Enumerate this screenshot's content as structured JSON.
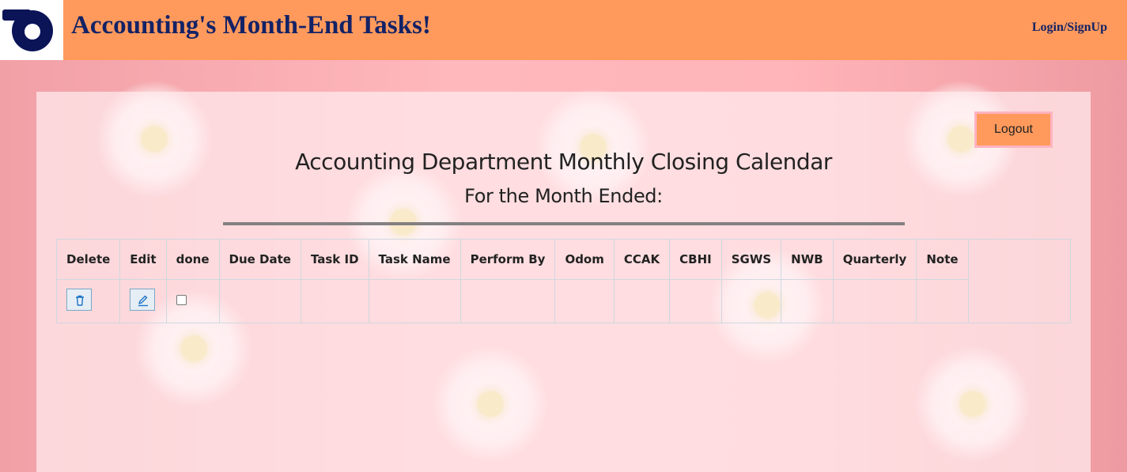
{
  "header": {
    "app_title": "Accounting's Month-End Tasks!",
    "login_link": "Login/SignUp",
    "logo_icon": "logo-icon"
  },
  "card": {
    "logout_label": "Logout",
    "title": "Accounting Department Monthly Closing Calendar",
    "subtitle": "For the Month Ended:"
  },
  "table": {
    "headers": [
      "Delete",
      "Edit",
      "done",
      "Due Date",
      "Task ID",
      "Task Name",
      "Perform By",
      "Odom",
      "CCAK",
      "CBHI",
      "SGWS",
      "NWB",
      "Quarterly",
      "Note"
    ],
    "rows": [
      {
        "delete_icon": "trash-icon",
        "edit_icon": "pencil-icon",
        "done": false,
        "due_date": "",
        "task_id": "",
        "task_name": "",
        "perform_by": "",
        "odom": "",
        "ccak": "",
        "cbhi": "",
        "sgws": "",
        "nwb": "",
        "quarterly": "",
        "note": ""
      }
    ]
  },
  "colors": {
    "header_bg": "#ff9a5c",
    "title_text": "#132266",
    "icon_blue": "#1a73c8"
  }
}
